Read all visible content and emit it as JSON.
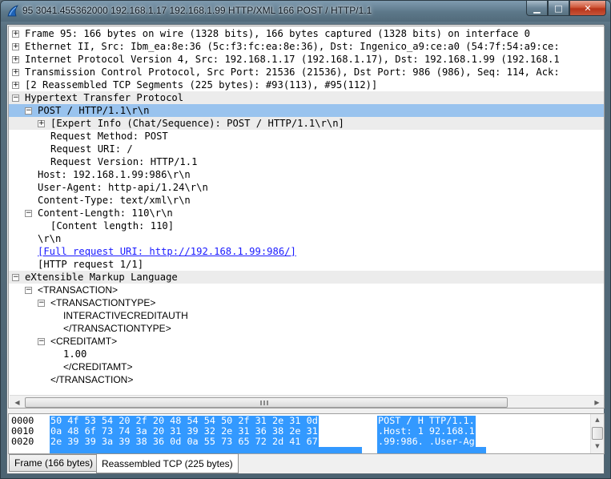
{
  "window": {
    "title": "95 3041.455362000 192.168.1.17 192.168.1.99 HTTP/XML 166 POST / HTTP/1.1",
    "minimize_label": "▁",
    "maximize_label": "□",
    "close_label": "✕"
  },
  "tree": {
    "frame": "Frame 95: 166 bytes on wire (1328 bits), 166 bytes captured (1328 bits) on interface 0",
    "ethernet": "Ethernet II, Src: Ibm_ea:8e:36 (5c:f3:fc:ea:8e:36), Dst: Ingenico_a9:ce:a0 (54:7f:54:a9:ce:",
    "ip": "Internet Protocol Version 4, Src: 192.168.1.17 (192.168.1.17), Dst: 192.168.1.99 (192.168.1",
    "tcp": "Transmission Control Protocol, Src Port: 21536 (21536), Dst Port: 986 (986), Seq: 114, Ack:",
    "reassembled": "[2 Reassembled TCP Segments (225 bytes): #93(113), #95(112)]",
    "http": "Hypertext Transfer Protocol",
    "post_line": "POST / HTTP/1.1\\r\\n",
    "expert_info": "[Expert Info (Chat/Sequence): POST / HTTP/1.1\\r\\n]",
    "req_method": "Request Method: POST",
    "req_uri": "Request URI: /",
    "req_version": "Request Version: HTTP/1.1",
    "host": "Host: 192.168.1.99:986\\r\\n",
    "user_agent": "User-Agent: http-api/1.24\\r\\n",
    "content_type": "Content-Type: text/xml\\r\\n",
    "content_length": "Content-Length: 110\\r\\n",
    "content_length_inner": "[Content length: 110]",
    "crlf": "\\r\\n",
    "full_uri": "[Full request URI: http://192.168.1.99:986/]",
    "http_request": "[HTTP request 1/1]",
    "xml": "eXtensible Markup Language",
    "transaction_open": "<TRANSACTION>",
    "transactiontype_open": "<TRANSACTIONTYPE>",
    "transactiontype_value": "INTERACTIVECREDITAUTH",
    "transactiontype_close": "</TRANSACTIONTYPE>",
    "creditamt_open": "<CREDITAMT>",
    "creditamt_value": "1.00",
    "creditamt_close": "</CREDITAMT>",
    "transaction_close": "</TRANSACTION>"
  },
  "bytes": {
    "rows": [
      {
        "offset": "0000",
        "hex": "50 4f 53 54 20 2f 20 48  54 54 50 2f 31 2e 31 0d",
        "ascii": "POST / H TTP/1.1."
      },
      {
        "offset": "0010",
        "hex": "0a 48 6f 73 74 3a 20 31  39 32 2e 31 36 38 2e 31",
        "ascii": ".Host: 1 92.168.1"
      },
      {
        "offset": "0020",
        "hex": "2e 39 39 3a 39 38 36 0d  0a 55 73 65 72 2d 41 67",
        "ascii": ".99:986. .User-Ag"
      }
    ]
  },
  "tabs": {
    "frame": "Frame (166 bytes)",
    "reassembled": "Reassembled TCP (225 bytes)"
  },
  "colors": {
    "selection": "#99c3ee",
    "byte_highlight": "#3399ff",
    "link": "#1a1aff"
  }
}
